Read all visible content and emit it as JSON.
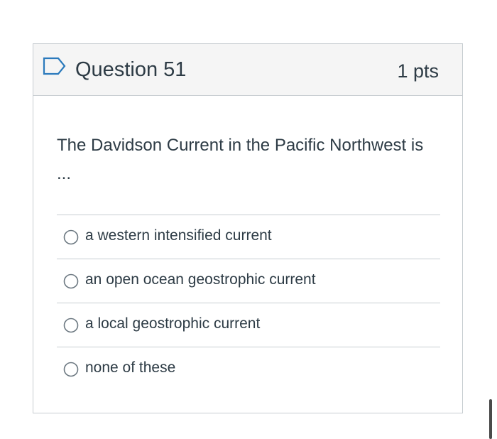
{
  "question": {
    "title": "Question 51",
    "points": "1 pts",
    "flag_icon": "flag-bookmark-icon",
    "text": "The Davidson Current in the Pacific Northwest is ...",
    "answers": [
      {
        "label": "a western intensified current"
      },
      {
        "label": "an open ocean geostrophic current"
      },
      {
        "label": "a local geostrophic current"
      },
      {
        "label": "none of these"
      }
    ]
  },
  "colors": {
    "header_bg": "#f5f5f5",
    "border": "#c7cdd1",
    "text": "#2d3b45",
    "flag_accent": "#2b7abc",
    "radio": "#6b7780"
  }
}
